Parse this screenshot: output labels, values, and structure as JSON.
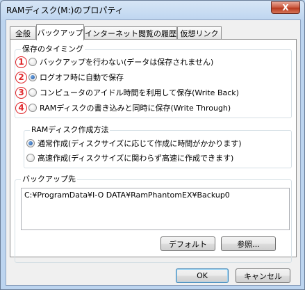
{
  "window": {
    "title": "RAMディスク(M:)のプロパティ",
    "close_glyph": "X"
  },
  "tabs": [
    {
      "label": "全般",
      "active": false
    },
    {
      "label": "バックアップ",
      "active": true
    },
    {
      "label": "インターネット閲覧の履歴",
      "active": false
    },
    {
      "label": "仮想リンク",
      "active": false
    }
  ],
  "timing": {
    "title": "保存のタイミング",
    "options": [
      {
        "badge": "1",
        "label": "バックアップを行わない(データは保存されません)",
        "checked": false
      },
      {
        "badge": "2",
        "label": "ログオフ時に自動で保存",
        "checked": true
      },
      {
        "badge": "3",
        "label": "コンピュータのアイドル時間を利用して保存(Write Back)",
        "checked": false
      },
      {
        "badge": "4",
        "label": "RAMディスクの書き込みと同時に保存(Write Through)",
        "checked": false
      }
    ]
  },
  "creation": {
    "title": "RAMディスク作成方法",
    "options": [
      {
        "label": "通常作成(ディスクサイズに応じて作成に時間がかかります)",
        "checked": true
      },
      {
        "label": "高速作成(ディスクサイズに関わらず高速に作成できます)",
        "checked": false
      }
    ]
  },
  "backup_dest": {
    "title": "バックアップ先",
    "path": "C:¥ProgramData¥I-O DATA¥RamPhantomEX¥Backup0",
    "default_label": "デフォルト",
    "browse_label": "参照..."
  },
  "footer": {
    "ok_label": "OK",
    "cancel_label": "キャンセル"
  },
  "colors": {
    "badge": "#e0262a",
    "titlebar": "#bcd4ef",
    "close": "#c8553c"
  }
}
